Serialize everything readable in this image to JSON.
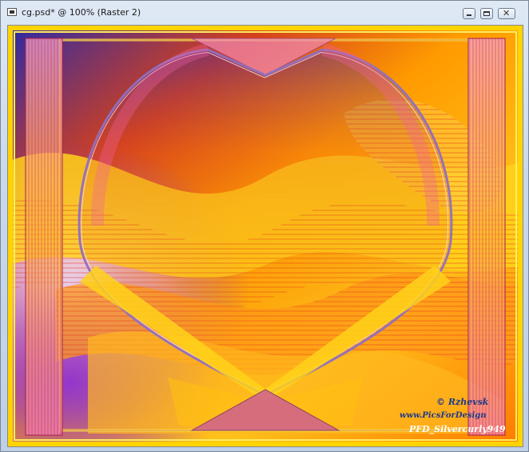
{
  "window": {
    "title": "cg.psd* @ 100% (Raster 2)",
    "icon": "document-icon",
    "controls": [
      "minimize-icon",
      "maximize-icon",
      "close-icon"
    ]
  },
  "artwork": {
    "signature_lines": [
      "© Rzhevsk",
      "www.PicsForDesign",
      "PFD_Silvercurly949"
    ],
    "colors": {
      "frame": "#ffd400",
      "orange": "#ff8a00",
      "red": "#e0301e",
      "purple": "#7a2cc8",
      "blue": "#2a2aa8",
      "pink": "#e88ab8"
    }
  }
}
